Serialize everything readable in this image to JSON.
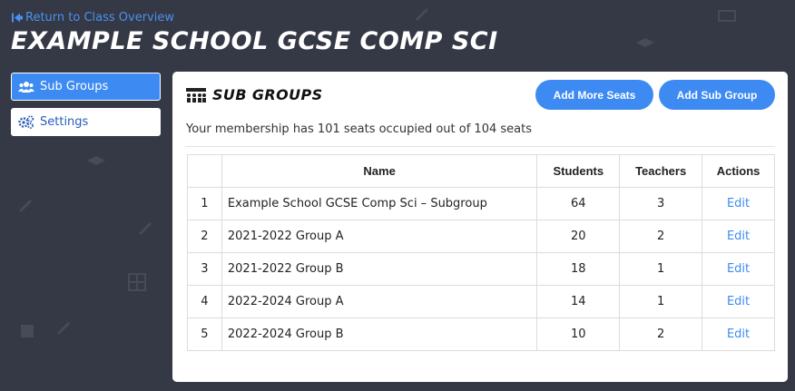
{
  "nav": {
    "back_label": "Return to Class Overview"
  },
  "page": {
    "title": "EXAMPLE SCHOOL GCSE COMP SCI"
  },
  "sidebar": {
    "items": [
      {
        "label": "Sub Groups",
        "icon": "users-icon",
        "active": true
      },
      {
        "label": "Settings",
        "icon": "gears-icon",
        "active": false
      }
    ]
  },
  "main": {
    "title": "SUB GROUPS",
    "add_seats_label": "Add More Seats",
    "add_subgroup_label": "Add Sub Group",
    "membership_text": "Your membership has 101 seats occupied out of 104 seats",
    "table": {
      "headers": [
        "",
        "Name",
        "Students",
        "Teachers",
        "Actions"
      ],
      "rows": [
        {
          "num": "1",
          "name": "Example School GCSE Comp Sci – Subgroup",
          "students": "64",
          "teachers": "3",
          "action": "Edit"
        },
        {
          "num": "2",
          "name": "2021-2022 Group A",
          "students": "20",
          "teachers": "2",
          "action": "Edit"
        },
        {
          "num": "3",
          "name": "2021-2022 Group B",
          "students": "18",
          "teachers": "1",
          "action": "Edit"
        },
        {
          "num": "4",
          "name": "2022-2024 Group A",
          "students": "14",
          "teachers": "1",
          "action": "Edit"
        },
        {
          "num": "5",
          "name": "2022-2024 Group B",
          "students": "10",
          "teachers": "2",
          "action": "Edit"
        }
      ]
    }
  },
  "colors": {
    "background": "#353945",
    "accent": "#3d8bf2",
    "link": "#4a90f0"
  }
}
